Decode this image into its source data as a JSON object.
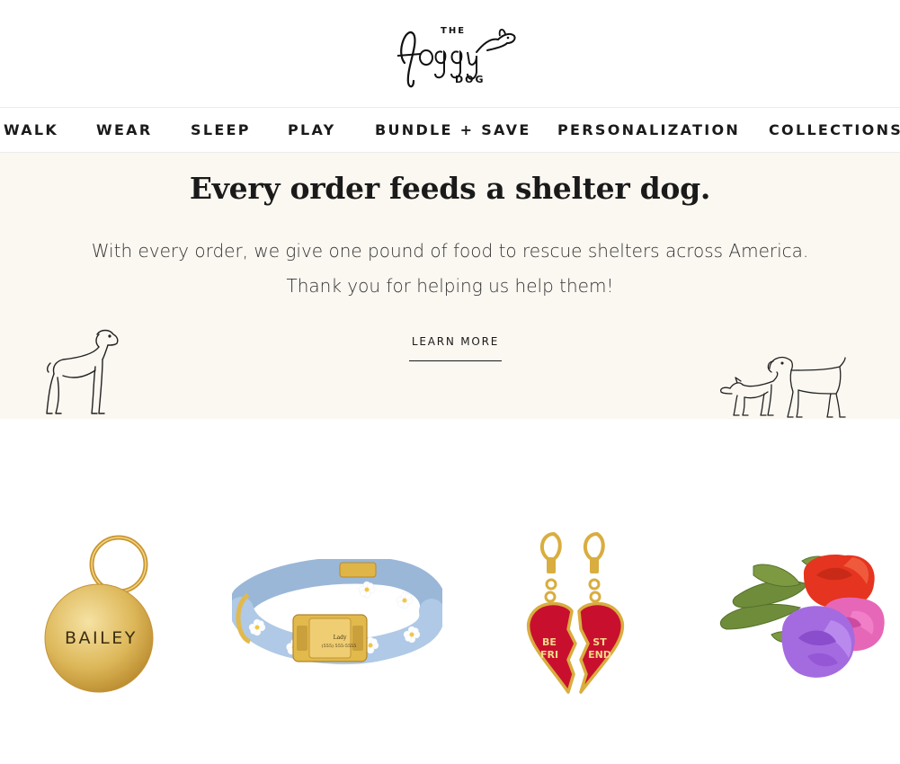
{
  "brand": {
    "top": "THE",
    "script": "foggy",
    "bottom": "DOG"
  },
  "nav": {
    "items": [
      "WALK",
      "WEAR",
      "SLEEP",
      "PLAY",
      "BUNDLE + SAVE",
      "PERSONALIZATION",
      "COLLECTIONS"
    ]
  },
  "banner": {
    "title": "Every order feeds a shelter dog.",
    "line1": "With every order, we give one pound of food to rescue shelters across America.",
    "line2": "Thank you for helping us help them!",
    "cta": "LEARN MORE"
  },
  "products": {
    "tag": {
      "engraving": "BAILEY"
    },
    "collar": {
      "plate_name": "Lady",
      "plate_phone": "(555) 555-5555"
    },
    "charm": {
      "left_top": "BE",
      "left_bottom": "FRI",
      "right_top": "ST",
      "right_bottom": "END"
    }
  },
  "colors": {
    "banner_bg": "#fbf7f1",
    "gold": "#d9b14a",
    "collar_blue": "#a9c3e0",
    "heart_red": "#c8102e",
    "rose_red": "#e5341f",
    "rose_pink": "#e667b8",
    "rose_purple": "#a46be0",
    "leaf_green": "#6e8c3a"
  }
}
